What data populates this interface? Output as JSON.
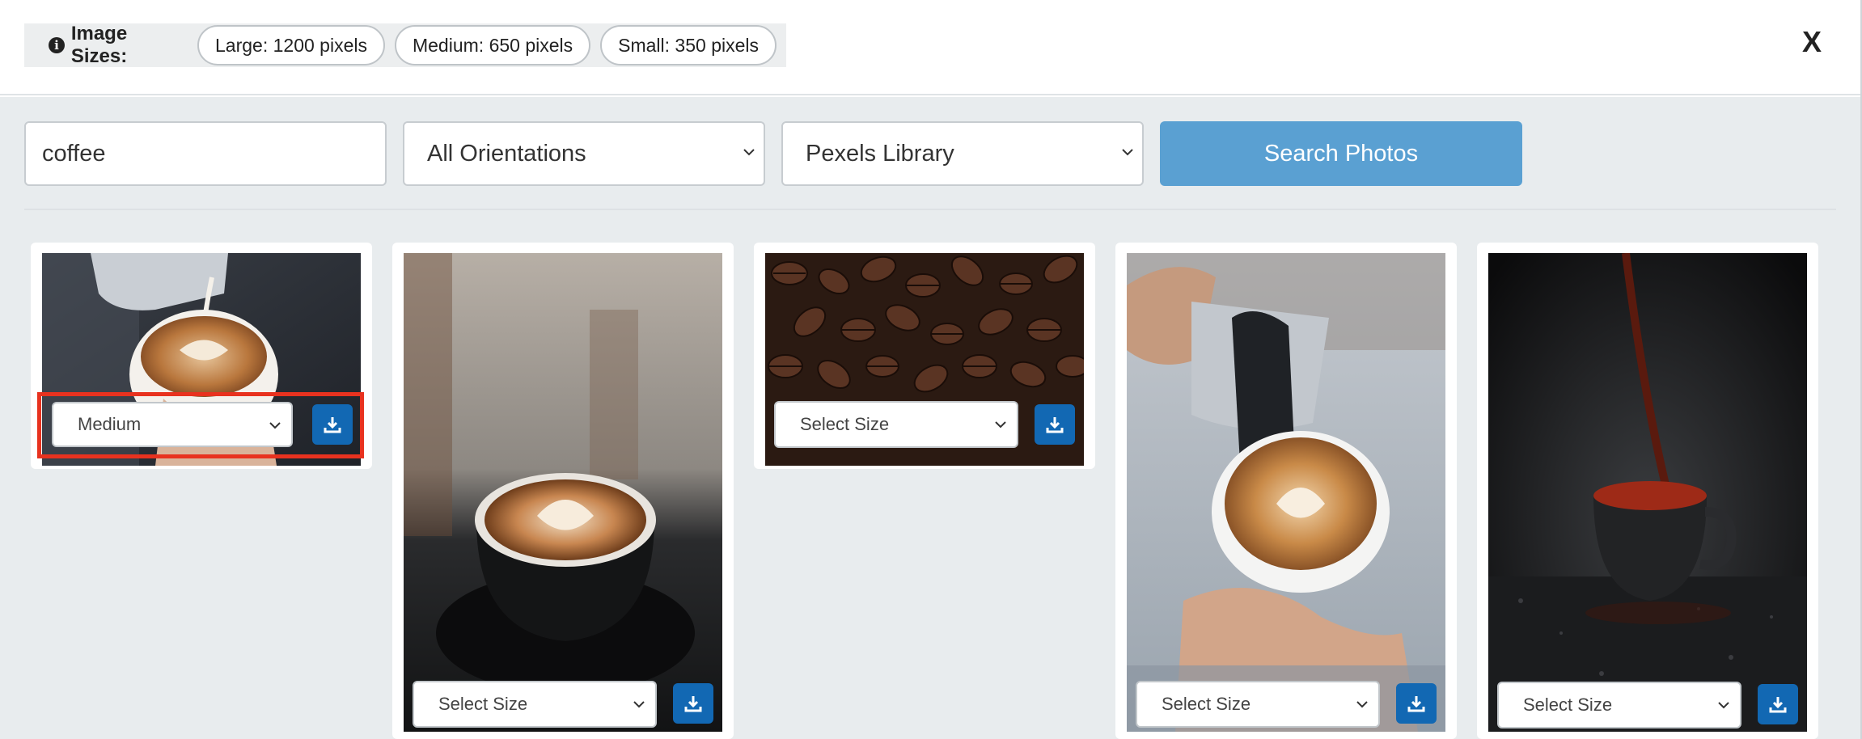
{
  "header": {
    "sizes_title": "Image Sizes:",
    "size_pills": [
      "Large: 1200 pixels",
      "Medium: 650 pixels",
      "Small: 350 pixels"
    ],
    "close_label": "X"
  },
  "search": {
    "query": "coffee",
    "orientation": "All Orientations",
    "library": "Pexels Library",
    "button_label": "Search Photos"
  },
  "photos": [
    {
      "description": "latte art pour",
      "size_value": "Medium",
      "highlighted": true
    },
    {
      "description": "latte in black cup",
      "size_value": "Select Size",
      "highlighted": false
    },
    {
      "description": "coffee beans",
      "size_value": "Select Size",
      "highlighted": false
    },
    {
      "description": "milk pour into cup",
      "size_value": "Select Size",
      "highlighted": false
    },
    {
      "description": "coffee pour on dark background",
      "size_value": "Select Size",
      "highlighted": false
    }
  ],
  "colors": {
    "search_button": "#5aa0d2",
    "download_button": "#1268b3",
    "highlight": "#e8321f",
    "background": "#e8ecee"
  },
  "icons": [
    "info-circle-icon",
    "close-icon",
    "chevron-down-icon",
    "download-icon"
  ]
}
